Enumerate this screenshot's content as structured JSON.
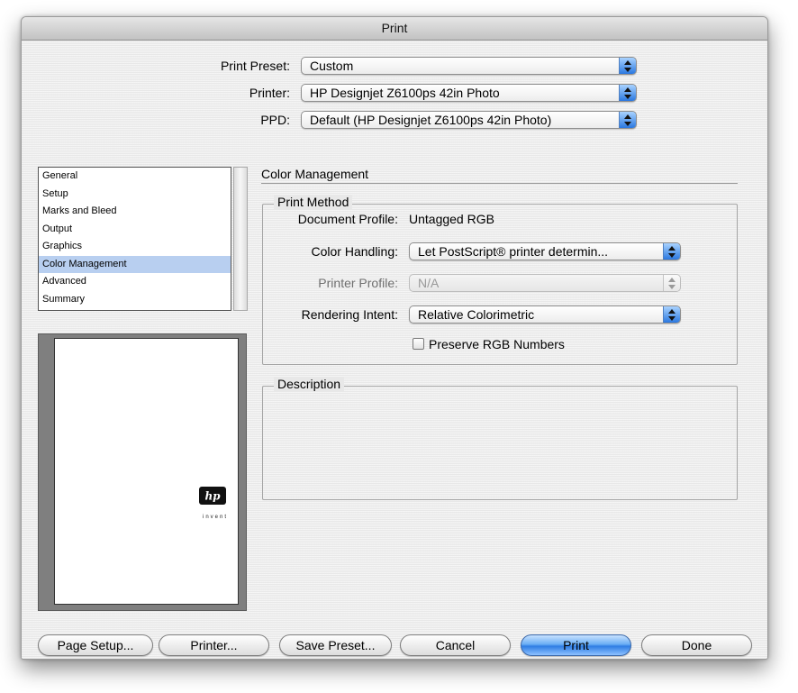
{
  "window": {
    "title": "Print"
  },
  "header": {
    "preset": {
      "label": "Print Preset:",
      "value": "Custom"
    },
    "printer": {
      "label": "Printer:",
      "value": "HP Designjet Z6100ps 42in Photo"
    },
    "ppd": {
      "label": "PPD:",
      "value": "Default (HP Designjet Z6100ps 42in Photo)"
    }
  },
  "sidebar": {
    "items": [
      "General",
      "Setup",
      "Marks and Bleed",
      "Output",
      "Graphics",
      "Color Management",
      "Advanced",
      "Summary"
    ],
    "selected": "Color Management"
  },
  "preview": {
    "logo_text": "hp",
    "logo_tagline": "invent"
  },
  "panel": {
    "title": "Color Management",
    "print_method": {
      "title": "Print Method",
      "document_profile_label": "Document Profile:",
      "document_profile_value": "Untagged RGB",
      "color_handling_label": "Color Handling:",
      "color_handling_value": "Let PostScript® printer determin...",
      "printer_profile_label": "Printer Profile:",
      "printer_profile_value": "N/A",
      "rendering_intent_label": "Rendering Intent:",
      "rendering_intent_value": "Relative Colorimetric",
      "preserve_rgb_label": "Preserve RGB Numbers",
      "preserve_rgb_checked": false
    },
    "description": {
      "title": "Description"
    }
  },
  "buttons": {
    "page_setup": "Page Setup...",
    "printer": "Printer...",
    "save_preset": "Save Preset...",
    "cancel": "Cancel",
    "print": "Print",
    "done": "Done"
  },
  "colors": {
    "selection": "#b8cff0",
    "accent_blue": "#2f7de4",
    "window_bg": "#e8e8e8"
  }
}
